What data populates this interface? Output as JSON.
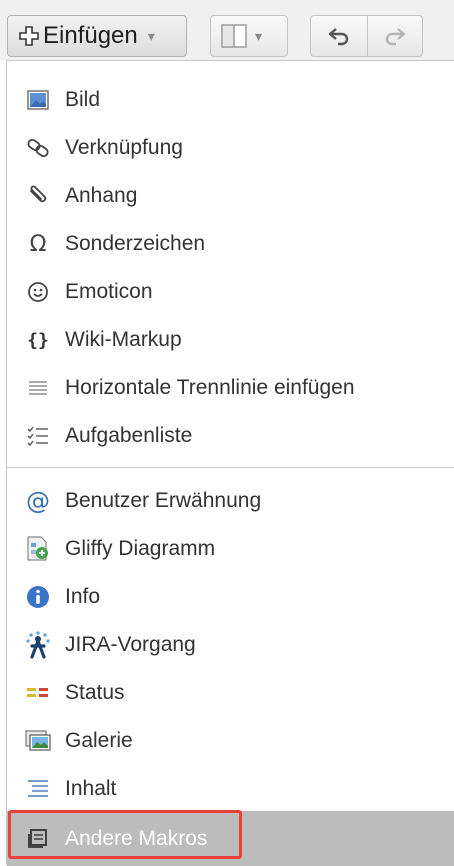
{
  "toolbar": {
    "insert_label": "Einfügen",
    "insert_caret": "▾",
    "layout_caret": "▾"
  },
  "menu": {
    "group1": [
      {
        "label": "Bild",
        "icon": "image-icon"
      },
      {
        "label": "Verknüpfung",
        "icon": "link-icon"
      },
      {
        "label": "Anhang",
        "icon": "paperclip-icon"
      },
      {
        "label": "Sonderzeichen",
        "icon": "omega-icon"
      },
      {
        "label": "Emoticon",
        "icon": "smiley-icon"
      },
      {
        "label": "Wiki-Markup",
        "icon": "braces-icon"
      },
      {
        "label": "Horizontale Trennlinie einfügen",
        "icon": "horizontal-rule-icon"
      },
      {
        "label": "Aufgabenliste",
        "icon": "task-list-icon"
      }
    ],
    "group2": [
      {
        "label": "Benutzer Erwähnung",
        "icon": "at-icon"
      },
      {
        "label": "Gliffy Diagramm",
        "icon": "gliffy-icon"
      },
      {
        "label": "Info",
        "icon": "info-icon"
      },
      {
        "label": "JIRA-Vorgang",
        "icon": "jira-icon"
      },
      {
        "label": "Status",
        "icon": "status-icon"
      },
      {
        "label": "Galerie",
        "icon": "gallery-icon"
      },
      {
        "label": "Inhalt",
        "icon": "toc-icon"
      },
      {
        "label": "Andere Makros",
        "icon": "macro-icon"
      }
    ]
  },
  "colors": {
    "highlight_background": "#bcbcbc",
    "annotation_border": "#e8433a",
    "info_blue": "#3b73c8",
    "at_blue": "#3572b0"
  }
}
